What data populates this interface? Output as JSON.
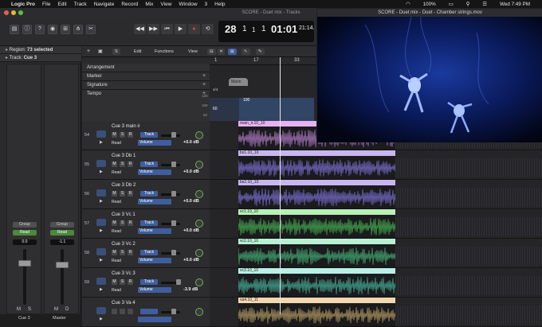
{
  "menubar": {
    "app_name": "Logic Pro",
    "items": [
      "File",
      "Edit",
      "Track",
      "Navigate",
      "Record",
      "Mix",
      "View",
      "Window",
      "3",
      "Help"
    ],
    "battery": "100%",
    "datetime": "Wed 7:49 PM"
  },
  "window": {
    "title": "SCORE - Duet mix - Tracks"
  },
  "lcd": {
    "bar": "28",
    "beat": "1",
    "division": "1",
    "tick": "1",
    "time": "01:01",
    "time_frac": "21:14."
  },
  "inspector": {
    "region_label": "Region:",
    "region_value": "73 selected",
    "track_label": "Track:",
    "track_value": "Cue 3",
    "strips": [
      {
        "group": "Group",
        "automation": "Read",
        "value": "0.0",
        "m": "M",
        "s": "S",
        "name": "Cue 3"
      },
      {
        "group": "Group",
        "automation": "Read",
        "value": "-1.1",
        "m": "M",
        "d": "D",
        "name": "Master"
      }
    ]
  },
  "track_toolbar": {
    "edit": "Edit",
    "functions": "Functions",
    "view": "View",
    "s_button": "S"
  },
  "globals": {
    "rows": [
      "Arrangement",
      "Marker",
      "Signature",
      "Tempo"
    ],
    "marker_label": "Marin",
    "signature_value": "4/4",
    "tempo_value": "100",
    "tempo_low": "60",
    "tempo_scale": [
      "120",
      "100",
      "80",
      "60"
    ]
  },
  "ruler": {
    "bars": [
      "1",
      "17",
      "33"
    ]
  },
  "tracks": [
    {
      "num": "54",
      "name": "Cue 3 main ir",
      "auto": "Read",
      "vol_label": "Volume",
      "track_btn": "Track",
      "db": "+0.0 dB",
      "region": "main_ir.10_10",
      "color": "#e6b2f2",
      "wave": "#9b6fb0",
      "m": "M",
      "s": "S",
      "r": "R"
    },
    {
      "num": "55",
      "name": "Cue 3 Db 1",
      "auto": "Read",
      "vol_label": "Volume",
      "track_btn": "Track",
      "db": "+0.0 dB",
      "region": "bs1.10_10",
      "color": "#c7b6f0",
      "wave": "#6f63b8",
      "m": "M",
      "s": "S",
      "r": "R"
    },
    {
      "num": "56",
      "name": "Cue 3 Db 2",
      "auto": "Read",
      "vol_label": "Volume",
      "track_btn": "Track",
      "db": "+0.0 dB",
      "region": "bs2.10_10",
      "color": "#c7b6f0",
      "wave": "#6f63b8",
      "m": "M",
      "s": "S",
      "r": "R"
    },
    {
      "num": "57",
      "name": "Cue 3 Vc 1",
      "auto": "Read",
      "vol_label": "Volume",
      "track_btn": "Track",
      "db": "+0.0 dB",
      "region": "vc1.10_10",
      "color": "#b8f0b8",
      "wave": "#3f9a4a",
      "m": "M",
      "s": "S",
      "r": "R"
    },
    {
      "num": "58",
      "name": "Cue 3 Vc 2",
      "auto": "Read",
      "vol_label": "Volume",
      "track_btn": "Track",
      "db": "+0.0 dB",
      "region": "vc2.10_10",
      "color": "#b8f0d2",
      "wave": "#3f9a6a",
      "m": "M",
      "s": "S",
      "r": "R"
    },
    {
      "num": "59",
      "name": "Cue 3 Vc 3",
      "auto": "Read",
      "vol_label": "Volume",
      "track_btn": "Track",
      "db": "-3.9 dB",
      "region": "vc3.10_10",
      "color": "#b8f0e6",
      "wave": "#3f9a86",
      "m": "M",
      "s": "S",
      "r": "R"
    },
    {
      "num": "",
      "name": "Cue 3 Va 4",
      "auto": "",
      "vol_label": "",
      "track_btn": "",
      "db": "",
      "region": "va4.10_11",
      "color": "#f2d8b0",
      "wave": "#a08a5a",
      "m": "",
      "s": "",
      "r": ""
    }
  ],
  "video": {
    "title": "SCORE - Duet mix - Duet - Chamber strings.mov"
  },
  "colors": {
    "accent_blue": "#3e5e9e",
    "automation_green": "#4a8a3a",
    "record_red": "#d23b30"
  }
}
